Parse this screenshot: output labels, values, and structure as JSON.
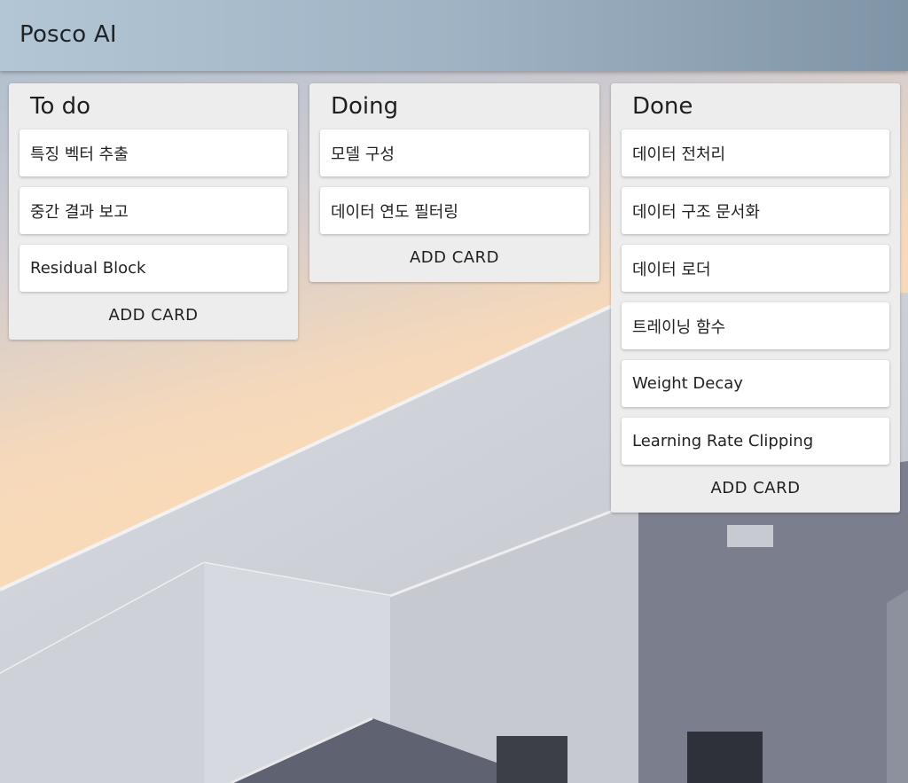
{
  "app": {
    "title": "Posco AI"
  },
  "colors": {
    "app_bar": "#9fb3c4",
    "column_bg": "#ededed",
    "card_bg": "#ffffff"
  },
  "columns": [
    {
      "title": "To do",
      "cards": [
        "특징 벡터 추출",
        "중간 결과 보고",
        "Residual Block"
      ],
      "add_label": "ADD CARD"
    },
    {
      "title": "Doing",
      "cards": [
        "모델 구성",
        "데이터 연도 필터링"
      ],
      "add_label": "ADD CARD"
    },
    {
      "title": "Done",
      "cards": [
        "데이터 전처리",
        "데이터 구조 문서화",
        "데이터 로더",
        "트레이닝 함수",
        "Weight Decay",
        "Learning Rate Clipping"
      ],
      "add_label": "ADD CARD"
    }
  ]
}
